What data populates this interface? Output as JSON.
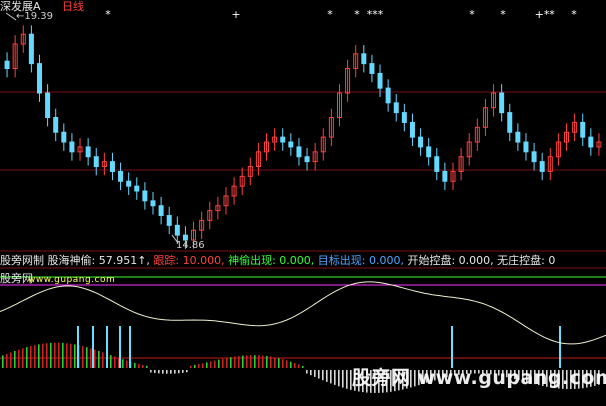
{
  "header": {
    "title": "深发展A",
    "period": "日线",
    "high_label": "19.39",
    "low_label": "14.86"
  },
  "indicator_bar": {
    "name": "股旁网制",
    "items": [
      {
        "label": "股海神偷",
        "value": "57.951",
        "color": "#e6e6e6",
        "arrow": "↑"
      },
      {
        "label": "跟踪",
        "value": "10.000",
        "color": "#ff4040"
      },
      {
        "label": "神偷出现",
        "value": "0.000",
        "color": "#33ff33"
      },
      {
        "label": "目标出现",
        "value": "0.000",
        "color": "#4da6ff"
      },
      {
        "label": "开始控盘",
        "value": "0.000",
        "color": "#e6e6e6"
      },
      {
        "label": "无庄控盘",
        "value": "0",
        "color": "#e6e6e6"
      }
    ]
  },
  "sub_panel": {
    "name": "股旁网",
    "url": "www.gupang.com"
  },
  "watermark": "股旁网 www.gupang.com",
  "signal_marks": [
    "*",
    "+",
    "*",
    "*",
    "***",
    "*",
    "*",
    "+*",
    "*",
    "*"
  ],
  "chart_data": {
    "type": "line",
    "title": "",
    "price_high": 19.39,
    "price_low": 14.86,
    "close": [
      18.4,
      18.9,
      19.1,
      18.5,
      17.9,
      17.4,
      17.1,
      16.9,
      16.7,
      16.8,
      16.6,
      16.4,
      16.5,
      16.3,
      16.1,
      16.0,
      15.9,
      15.7,
      15.6,
      15.4,
      15.2,
      15.0,
      14.9,
      15.1,
      15.3,
      15.5,
      15.6,
      15.8,
      16.0,
      16.2,
      16.4,
      16.7,
      16.9,
      17.0,
      16.9,
      16.8,
      16.6,
      16.5,
      16.7,
      17.0,
      17.4,
      17.9,
      18.4,
      18.7,
      18.5,
      18.3,
      18.0,
      17.7,
      17.5,
      17.3,
      17.0,
      16.8,
      16.6,
      16.3,
      16.1,
      16.3,
      16.6,
      16.9,
      17.2,
      17.6,
      17.9,
      17.5,
      17.1,
      16.9,
      16.7,
      16.5,
      16.3,
      16.6,
      16.9,
      17.1,
      17.3,
      17.0,
      16.8,
      16.9
    ],
    "color_up": "#ff4040",
    "color_down": "#66d9ff"
  }
}
